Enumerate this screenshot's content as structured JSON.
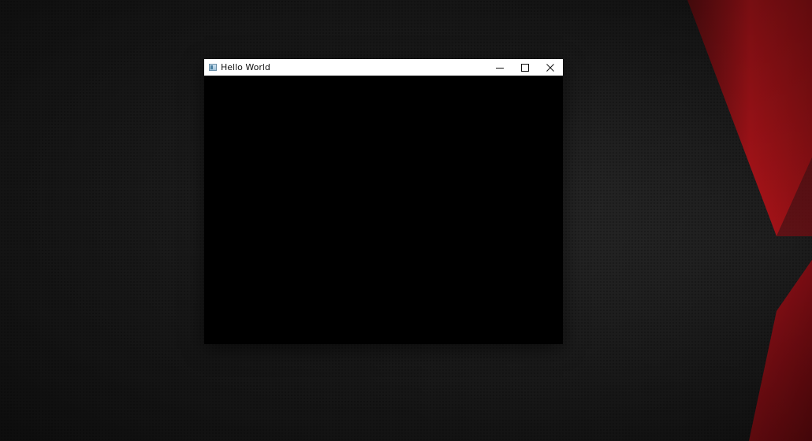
{
  "window": {
    "title": "Hello World",
    "icon": "app-window-icon",
    "client_background": "#000000",
    "titlebar_background": "#ffffff"
  },
  "caption_buttons": {
    "minimize_icon": "minimize-icon",
    "maximize_icon": "maximize-icon",
    "close_icon": "close-icon"
  },
  "desktop": {
    "background_color": "#2a2a2a",
    "accent_color": "#b0141a"
  }
}
